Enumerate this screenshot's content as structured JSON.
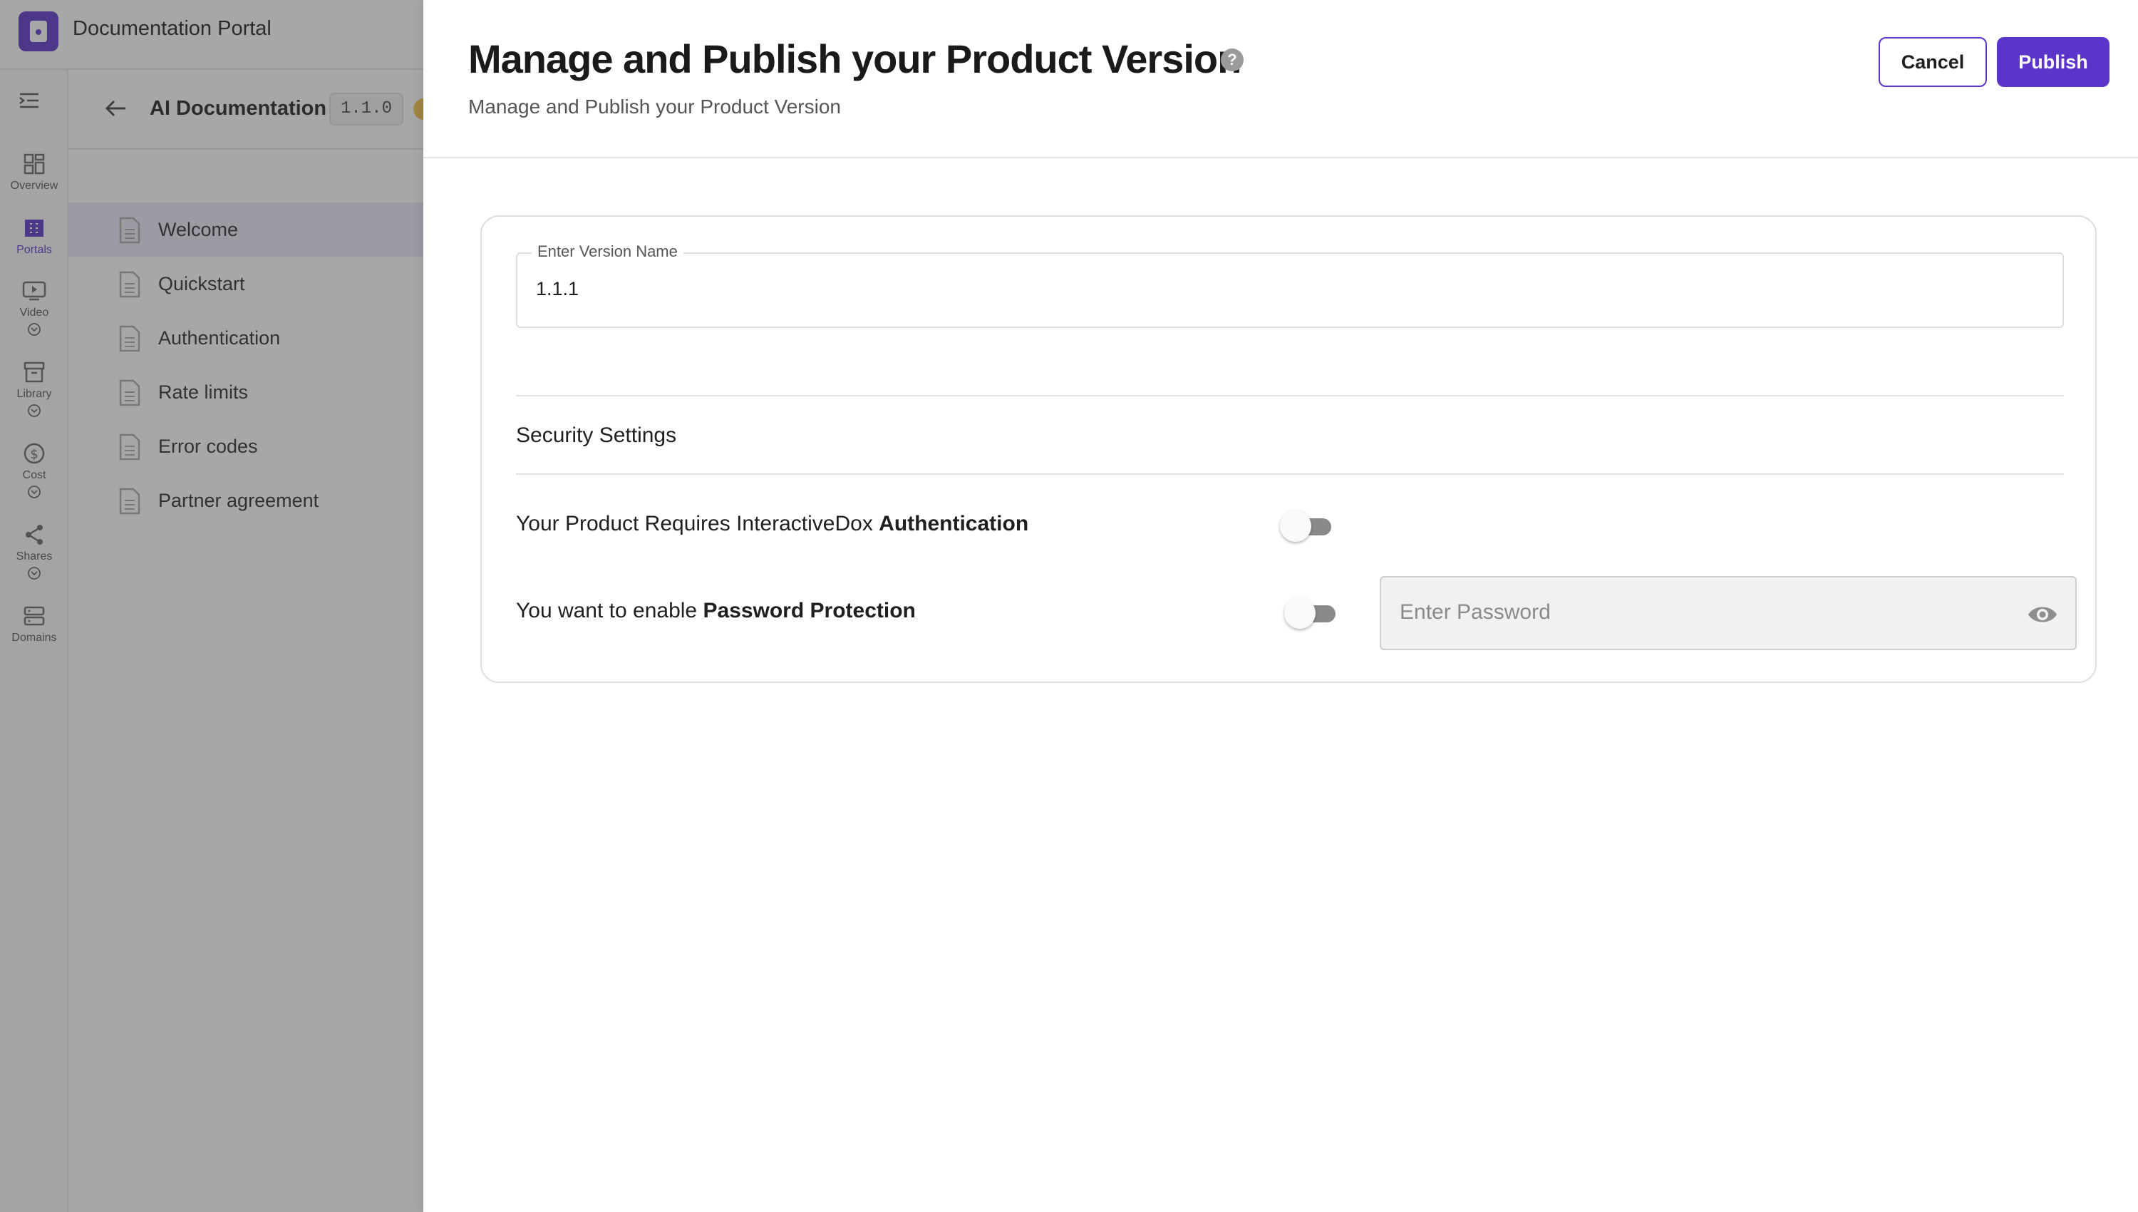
{
  "app": {
    "title": "Documentation Portal"
  },
  "rail": {
    "items": [
      {
        "label": "Overview",
        "icon": "grid-icon"
      },
      {
        "label": "Portals",
        "icon": "building-icon",
        "active": true
      },
      {
        "label": "Video",
        "icon": "video-icon"
      },
      {
        "label": "Library",
        "icon": "archive-icon"
      },
      {
        "label": "Cost",
        "icon": "dollar-icon"
      },
      {
        "label": "Shares",
        "icon": "share-icon"
      },
      {
        "label": "Domains",
        "icon": "server-icon"
      }
    ]
  },
  "doc": {
    "title": "AI Documentation",
    "version": "1.1.0",
    "pages": [
      "Welcome",
      "Quickstart",
      "Authentication",
      "Rate limits",
      "Error codes",
      "Partner agreement"
    ]
  },
  "drawer": {
    "title": "Manage and Publish your Product Version",
    "subtitle": "Manage and Publish your Product Version",
    "help_icon": "?",
    "cancel_label": "Cancel",
    "publish_label": "Publish",
    "version_field": {
      "label": "Enter Version Name",
      "value": "1.1.1"
    },
    "security": {
      "title": "Security Settings",
      "auth_prefix": "Your Product Requires InteractiveDox ",
      "auth_bold": "Authentication",
      "auth_enabled": false,
      "pw_prefix": "You want to enable ",
      "pw_bold": "Password Protection",
      "pw_enabled": false,
      "pw_placeholder": "Enter Password"
    }
  },
  "colors": {
    "accent": "#5b34c9",
    "overlay": "#3c3c3c"
  }
}
